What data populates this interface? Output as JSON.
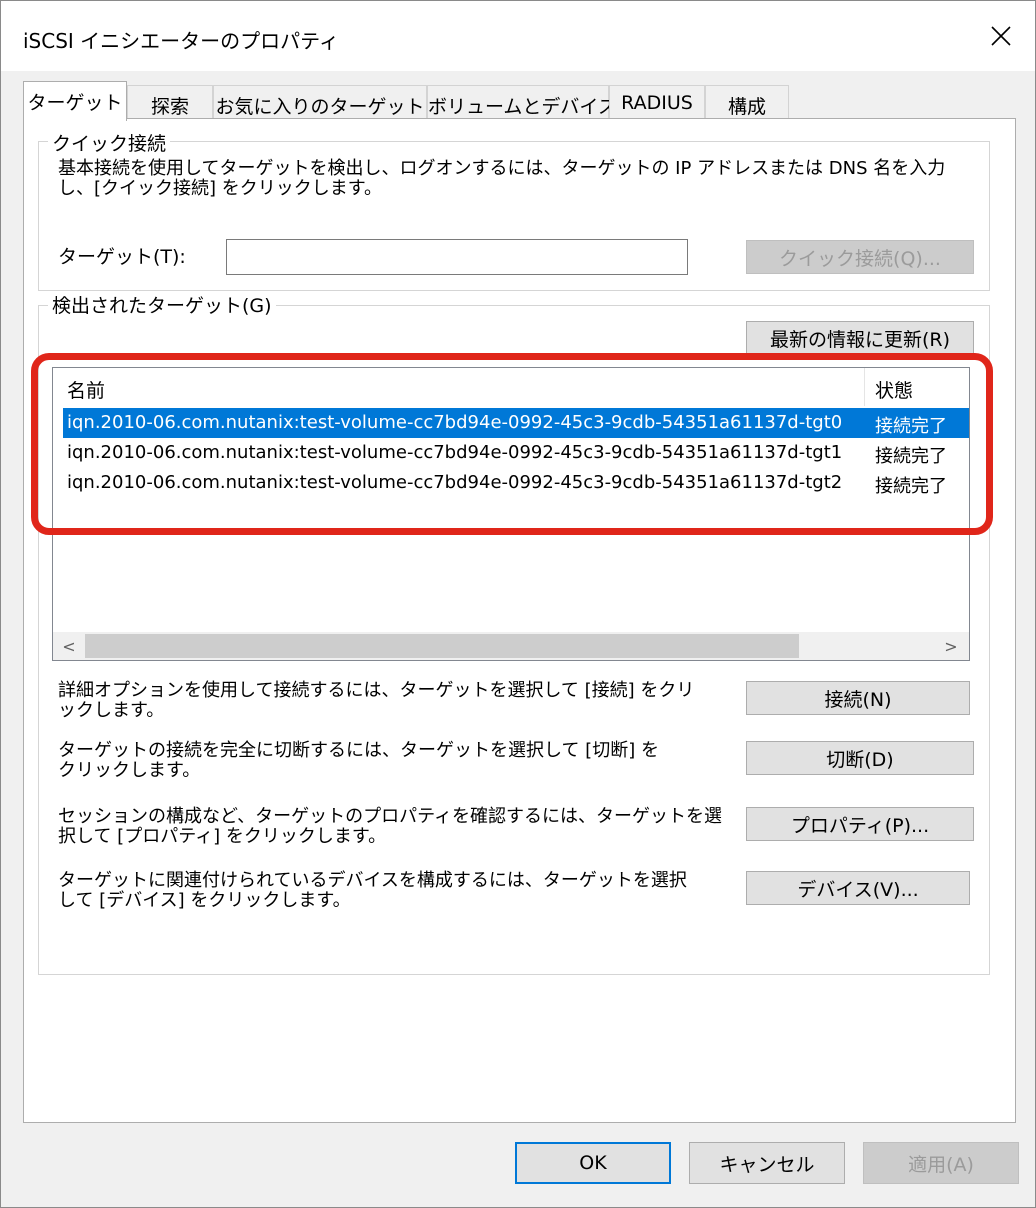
{
  "window": {
    "title": "iSCSI イニシエーターのプロパティ",
    "close_icon": "close-icon"
  },
  "tabs": [
    {
      "label": "ターゲット",
      "active": true
    },
    {
      "label": "探索",
      "active": false
    },
    {
      "label": "お気に入りのターゲット",
      "active": false
    },
    {
      "label": "ボリュームとデバイス",
      "active": false
    },
    {
      "label": "RADIUS",
      "active": false
    },
    {
      "label": "構成",
      "active": false
    }
  ],
  "quick_connect": {
    "group_label": "クイック接続",
    "description_line1": "基本接続を使用してターゲットを検出し、ログオンするには、ターゲットの IP アドレスまたは DNS 名を入力",
    "description_line2": "し、[クイック接続] をクリックします。",
    "target_label": "ターゲット(T):",
    "target_value": "",
    "button": "クイック接続(Q)..."
  },
  "discovered": {
    "group_label": "検出されたターゲット(G)",
    "refresh_button": "最新の情報に更新(R)",
    "columns": [
      "名前",
      "状態"
    ],
    "rows": [
      {
        "name": "iqn.2010-06.com.nutanix:test-volume-cc7bd94e-0992-45c3-9cdb-54351a61137d-tgt0",
        "status": "接続完了",
        "selected": true
      },
      {
        "name": "iqn.2010-06.com.nutanix:test-volume-cc7bd94e-0992-45c3-9cdb-54351a61137d-tgt1",
        "status": "接続完了",
        "selected": false
      },
      {
        "name": "iqn.2010-06.com.nutanix:test-volume-cc7bd94e-0992-45c3-9cdb-54351a61137d-tgt2",
        "status": "接続完了",
        "selected": false
      }
    ],
    "scroll_left": "<",
    "scroll_right": ">"
  },
  "actions": [
    {
      "line1": "詳細オプションを使用して接続するには、ターゲットを選択して [接続] をクリ",
      "line2": "ックします。",
      "button": "接続(N)"
    },
    {
      "line1": "ターゲットの接続を完全に切断するには、ターゲットを選択して [切断] を",
      "line2": "クリックします。",
      "button": "切断(D)"
    },
    {
      "line1": "セッションの構成など、ターゲットのプロパティを確認するには、ターゲットを選",
      "line2": "択して [プロパティ] をクリックします。",
      "button": "プロパティ(P)..."
    },
    {
      "line1": "ターゲットに関連付けられているデバイスを構成するには、ターゲットを選択",
      "line2": "して [デバイス] をクリックします。",
      "button": "デバイス(V)..."
    }
  ],
  "footer": {
    "ok": "OK",
    "cancel": "キャンセル",
    "apply": "適用(A)"
  },
  "colors": {
    "selection": "#0078d7",
    "highlight": "#e0261a"
  }
}
